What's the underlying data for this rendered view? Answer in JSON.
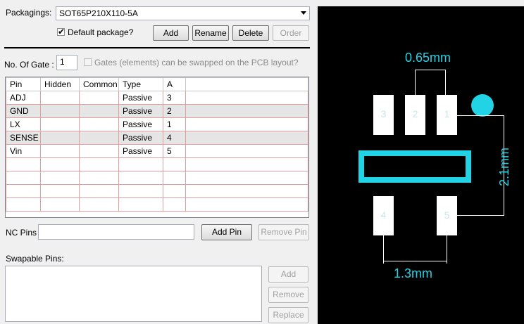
{
  "packaging": {
    "label": "Packagings:",
    "selected": "SOT65P210X110-5A",
    "default_label": "Default package?",
    "default_checked": true,
    "buttons": {
      "add": "Add",
      "rename": "Rename",
      "delete": "Delete",
      "order": "Order"
    }
  },
  "gates": {
    "label": "No. Of Gate :",
    "value": "1",
    "swap_label": "Gates (elements) can be swapped on the PCB layout?",
    "swap_checked": false
  },
  "pin_table": {
    "columns": [
      "Pin",
      "Hidden",
      "Common",
      "Type",
      "A"
    ],
    "rows": [
      {
        "pin": "ADJ",
        "hidden": "",
        "common": "",
        "type": "Passive",
        "a": "3"
      },
      {
        "pin": "GND",
        "hidden": "",
        "common": "",
        "type": "Passive",
        "a": "2"
      },
      {
        "pin": "LX",
        "hidden": "",
        "common": "",
        "type": "Passive",
        "a": "1"
      },
      {
        "pin": "SENSE",
        "hidden": "",
        "common": "",
        "type": "Passive",
        "a": "4"
      },
      {
        "pin": "Vin",
        "hidden": "",
        "common": "",
        "type": "Passive",
        "a": "5"
      }
    ]
  },
  "nc_pins": {
    "label": "NC Pins",
    "value": "",
    "add_button": "Add Pin",
    "remove_button": "Remove Pin"
  },
  "swapable": {
    "label": "Swapable Pins:",
    "add_button": "Add",
    "remove_button": "Remove",
    "replace_button": "Replace"
  },
  "footprint": {
    "pads_top": [
      "3",
      "2",
      "1"
    ],
    "pads_bottom": [
      "4",
      "5"
    ],
    "dim_pitch": "0.65mm",
    "dim_height": "2.1mm",
    "dim_span": "1.3mm",
    "colors": {
      "background": "#000000",
      "pad": "#ffffff",
      "dimension": "#22d3e6"
    }
  }
}
